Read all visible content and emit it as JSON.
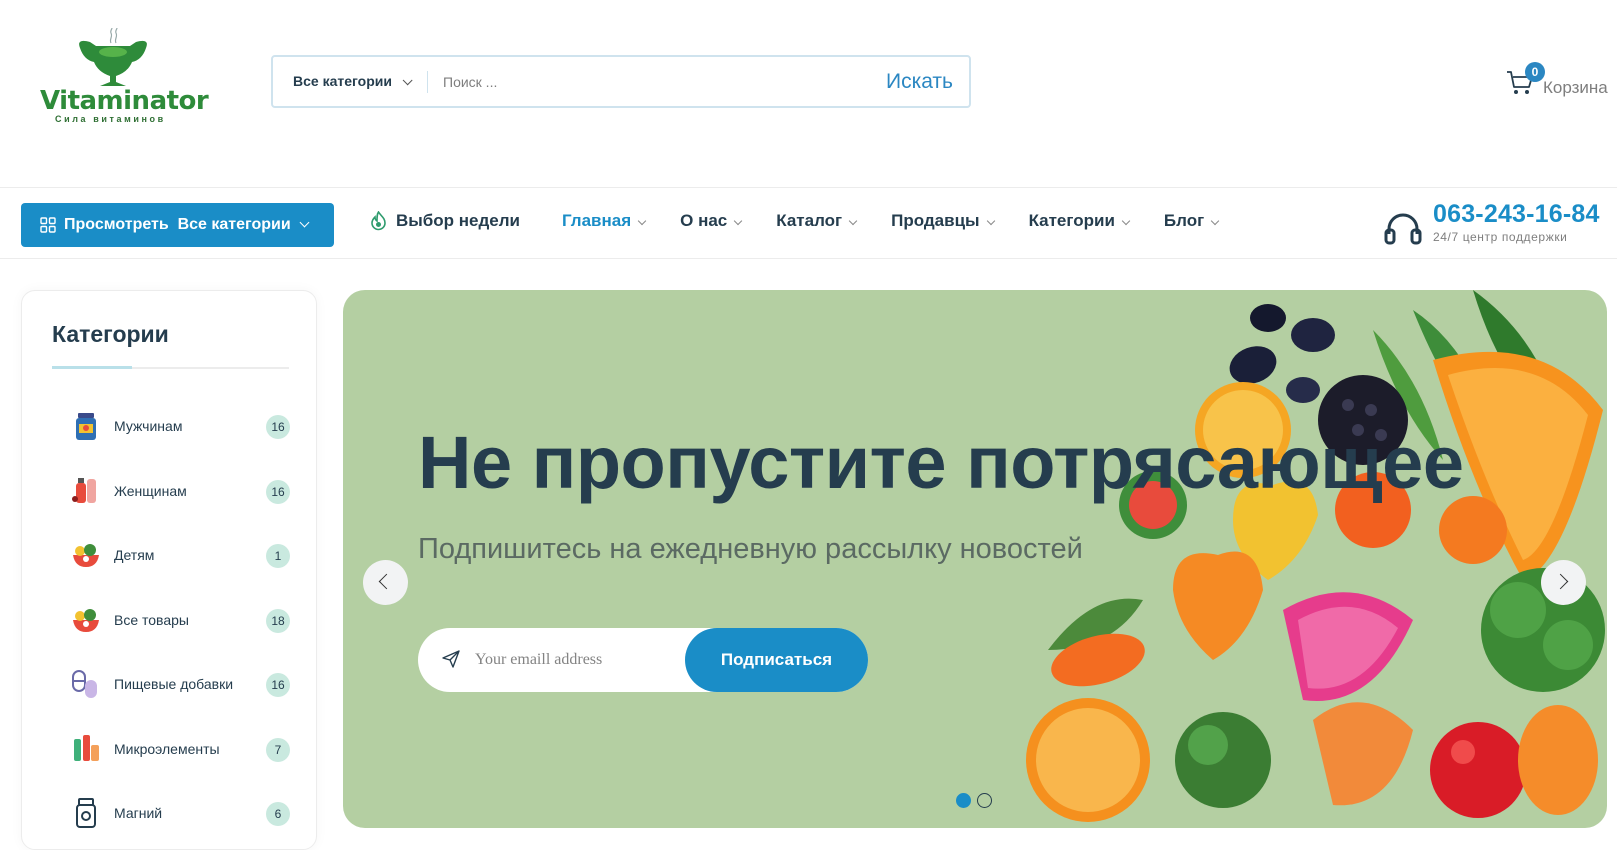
{
  "brand": {
    "name": "Vitaminator",
    "tagline": "Сила витаминов",
    "color": "#2e8b3a"
  },
  "search": {
    "category_label": "Все категории",
    "placeholder": "Поиск ...",
    "value": "",
    "button_label": "Искать"
  },
  "cart": {
    "count": "0",
    "label": "Корзина",
    "icon": "cart-icon"
  },
  "nav": {
    "browse_label": "Просмотреть  Все категории",
    "week_label": "Выбор недели",
    "items": [
      {
        "label": "Главная",
        "active": true
      },
      {
        "label": "О нас"
      },
      {
        "label": "Каталог"
      },
      {
        "label": "Продавцы"
      },
      {
        "label": "Категории"
      },
      {
        "label": "Блог"
      }
    ],
    "support_phone": "063-243-16-84",
    "support_note": "24/7 центр поддержки"
  },
  "sidebar": {
    "title": "Категории",
    "items": [
      {
        "name": "Мужчинам",
        "count": "16",
        "icon": "supplement-jar-icon"
      },
      {
        "name": "Женщинам",
        "count": "16",
        "icon": "bottles-icon"
      },
      {
        "name": "Детям",
        "count": "1",
        "icon": "fruit-bowl-icon"
      },
      {
        "name": "Все товары",
        "count": "18",
        "icon": "fruit-bowl-icon"
      },
      {
        "name": "Пищевые добавки",
        "count": "16",
        "icon": "capsules-icon"
      },
      {
        "name": "Микроэлементы",
        "count": "7",
        "icon": "vials-icon"
      },
      {
        "name": "Магний",
        "count": "6",
        "icon": "pill-bottle-icon"
      }
    ]
  },
  "hero": {
    "headline": "Не пропустите потрясающее",
    "subheadline": "Подпишитесь на ежедневную рассылку новостей",
    "email_placeholder": "Your emaill address",
    "email_value": "",
    "subscribe_label": "Подписаться",
    "slides_total": 2,
    "slide_active": 1,
    "background_color": "#b4cfa2"
  },
  "colors": {
    "accent": "#1a8dc7",
    "text": "#253d4e",
    "count_badge": "#c9e9df"
  }
}
